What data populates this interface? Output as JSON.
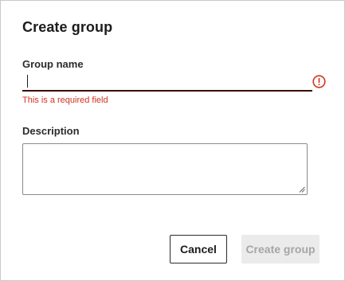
{
  "dialog": {
    "title": "Create group"
  },
  "group_name": {
    "label": "Group name",
    "value": "",
    "error": "This is a required field"
  },
  "description": {
    "label": "Description",
    "value": ""
  },
  "buttons": {
    "cancel": "Cancel",
    "create": "Create group"
  },
  "icons": {
    "error": "error-circle-icon"
  },
  "colors": {
    "error": "#d1321f",
    "input_underline": "#3a0c08",
    "disabled_bg": "#ebebeb",
    "disabled_text": "#a6a6a6"
  }
}
